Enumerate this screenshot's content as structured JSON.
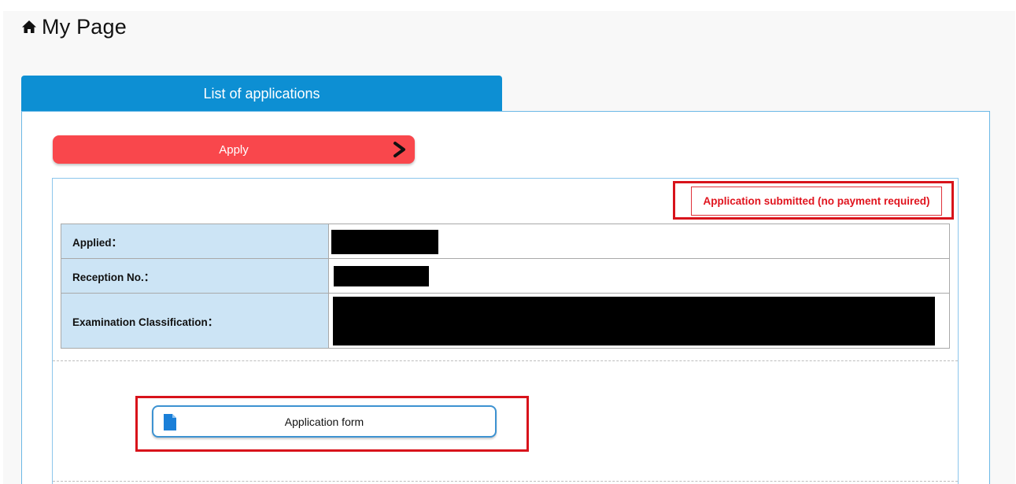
{
  "page": {
    "title": "My Page",
    "title_icon": "home-icon"
  },
  "tabs": [
    {
      "label": "List of applications",
      "active": true
    }
  ],
  "apply_button": {
    "label": "Apply",
    "icon": "chevron-right-icon",
    "color": "#f9474c"
  },
  "application": {
    "status": "Application submitted (no payment required)",
    "status_color": "#e0141e",
    "fields": [
      {
        "label": "Applied：",
        "value_redacted": true
      },
      {
        "label": "Reception No.：",
        "value_redacted": true
      },
      {
        "label": "Examination Classification：",
        "value_redacted": true
      }
    ],
    "form_button": {
      "label": "Application form",
      "icon": "document-icon"
    }
  },
  "colors": {
    "tab": "#0d8fd3",
    "label_bg": "#cce4f5",
    "highlight": "#d8131b"
  }
}
